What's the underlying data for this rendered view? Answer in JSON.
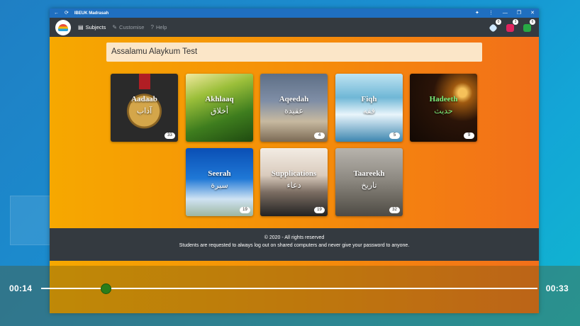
{
  "window": {
    "title": "IBEUK Madrasah",
    "back_glyph": "←",
    "reload_glyph": "⟳",
    "extensions_glyph": "✦",
    "menu_glyph": "⋮",
    "minimize_glyph": "—",
    "restore_glyph": "❐",
    "close_glyph": "✕"
  },
  "nav": {
    "items": [
      {
        "label": "Subjects",
        "icon": "book-icon",
        "glyph": "▤",
        "active": true
      },
      {
        "label": "Customise",
        "icon": "brush-icon",
        "glyph": "✎",
        "active": false
      },
      {
        "label": "Help",
        "icon": "question-icon",
        "glyph": "?",
        "active": false
      }
    ],
    "badges": [
      {
        "icon": "diamond-icon",
        "count": "0"
      },
      {
        "icon": "ruby-icon",
        "count": "3"
      },
      {
        "icon": "emerald-icon",
        "count": "6"
      }
    ]
  },
  "greeting": "Assalamu Alaykum Test",
  "subjects": [
    {
      "title": "Aadaab",
      "arabic": "آداب",
      "count": "33"
    },
    {
      "title": "Akhlaaq",
      "arabic": "أخلاق",
      "count": ""
    },
    {
      "title": "Aqeedah",
      "arabic": "عقيدة",
      "count": "4"
    },
    {
      "title": "Fiqh",
      "arabic": "فقه",
      "count": "5"
    },
    {
      "title": "Hadeeth",
      "arabic": "حديث",
      "count": "9",
      "accent": "#7cf07c"
    },
    {
      "title": "Seerah",
      "arabic": "سيرة",
      "count": "19"
    },
    {
      "title": "Supplications",
      "arabic": "دعاء",
      "count": "19"
    },
    {
      "title": "Taareekh",
      "arabic": "تاريخ",
      "count": "32"
    }
  ],
  "footer": {
    "copyright": "© 2020 - All rights reserved",
    "notice": "Students are requested to always log out on shared computers and never give your password to anyone."
  },
  "player": {
    "current_time": "00:14",
    "total_time": "00:33",
    "progress": 0.13
  },
  "colors": {
    "accent_orange": "#f58c0a",
    "nav_dark": "#343a40",
    "title_blue": "#1f6fc0",
    "thumb_green": "#2a7d1a"
  }
}
